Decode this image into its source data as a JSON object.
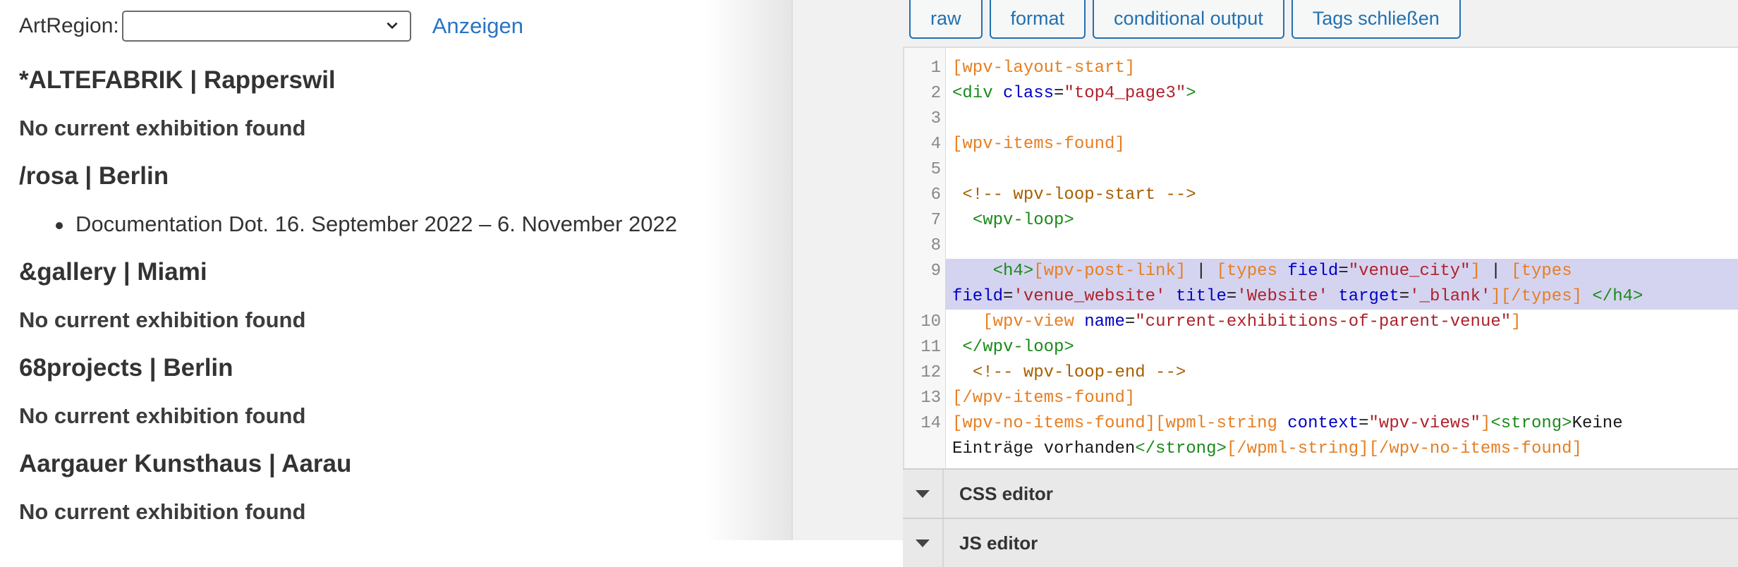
{
  "preview": {
    "filter_label": "ArtRegion:",
    "select_value": "",
    "show_link": "Anzeigen",
    "venues": [
      {
        "title": "*ALTEFABRIK | Rapperswil",
        "status": "No current exhibition found"
      },
      {
        "title": "/rosa | Berlin",
        "exhibitions": [
          "Documentation Dot. 16. September 2022 – 6. November 2022"
        ]
      },
      {
        "title": "&gallery | Miami",
        "status": "No current exhibition found"
      },
      {
        "title": "68projects | Berlin",
        "status": "No current exhibition found"
      },
      {
        "title": "Aargauer Kunsthaus | Aarau",
        "status": "No current exhibition found"
      }
    ]
  },
  "editor": {
    "toolbar": [
      "raw",
      "format",
      "conditional output",
      "Tags schließen"
    ],
    "line_numbers": [
      "1",
      "2",
      "3",
      "4",
      "5",
      "6",
      "7",
      "8",
      "9",
      "",
      "10",
      "11",
      "12",
      "13",
      "14",
      ""
    ],
    "panels": [
      "CSS editor",
      "JS editor"
    ]
  }
}
